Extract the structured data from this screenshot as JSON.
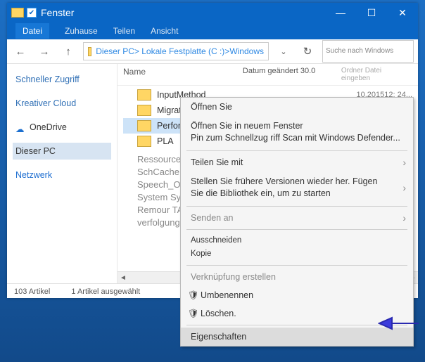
{
  "window": {
    "title": "Fenster",
    "menu": {
      "file": "Datei",
      "home": "Zuhause",
      "share": "Teilen",
      "view": "Ansicht"
    },
    "breadcrumb": "Dieser PC> Lokale Festplatte (C :)>Windows",
    "search_placeholder": "Suche nach Windows"
  },
  "sidebar": {
    "quick": "Schneller Zugriff",
    "creative": "Kreativer Cloud",
    "onedrive": "OneDrive",
    "thispc": "Dieser PC",
    "network": "Netzwerk"
  },
  "columns": {
    "name": "Name",
    "date": "Datum geändert 30.0",
    "type": "Ordner Datei eingeben"
  },
  "date_sample": "10.201512: 24...",
  "files": {
    "f0": "InputMethod",
    "f1": "Migration",
    "f2": "Performance",
    "f3": "PLA",
    "rest": "Ressourcen SchCache Speech Speech_OneC-System System Remour TAPI-Rück verfolgung"
  },
  "status": {
    "count": "103 Artikel",
    "selected": "1 Artikel ausgewählt"
  },
  "ctx": {
    "open": "Öffnen Sie",
    "open_new": "Öffnen Sie in neuem Fenster",
    "pin": " Pin zum Schnellzug riff Scan mit Windows Defender...",
    "share": "Teilen Sie mit",
    "restore": "Stellen Sie frühere Versionen wieder her. Fügen Sie die Bibliothek ein, um zu starten",
    "sendto": "Senden an",
    "cut": "Ausschneiden",
    "copy": "Kopie",
    "shortcut": "Verknüpfung erstellen",
    "rename": "Umbenennen",
    "delete": "Löschen.",
    "props": "Eigenschaften"
  }
}
